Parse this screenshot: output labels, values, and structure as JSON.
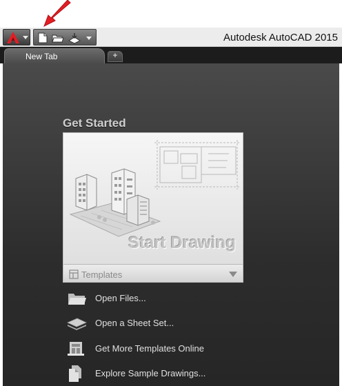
{
  "window": {
    "title": "Autodesk AutoCAD 2015"
  },
  "tabs": [
    {
      "label": "New Tab",
      "active": true
    }
  ],
  "tab_add_label": "+",
  "get_started": {
    "heading": "Get Started",
    "start_drawing_label": "Start Drawing",
    "templates_label": "Templates"
  },
  "links": [
    {
      "label": "Open Files...",
      "icon": "folder-icon"
    },
    {
      "label": "Open a Sheet Set...",
      "icon": "sheet-set-icon"
    },
    {
      "label": "Get More Templates Online",
      "icon": "templates-online-icon"
    },
    {
      "label": "Explore Sample Drawings...",
      "icon": "sample-drawings-icon"
    }
  ],
  "icons": {
    "app_logo": "autocad-logo-icon",
    "qat_new": "new-file-icon",
    "qat_open": "open-folder-icon",
    "qat_save": "save-icon",
    "annotation": "red-arrow-icon"
  },
  "colors": {
    "accent_red": "#e31e24",
    "background_dark": "#2d2d2d",
    "text_light": "#e0e0e0"
  }
}
